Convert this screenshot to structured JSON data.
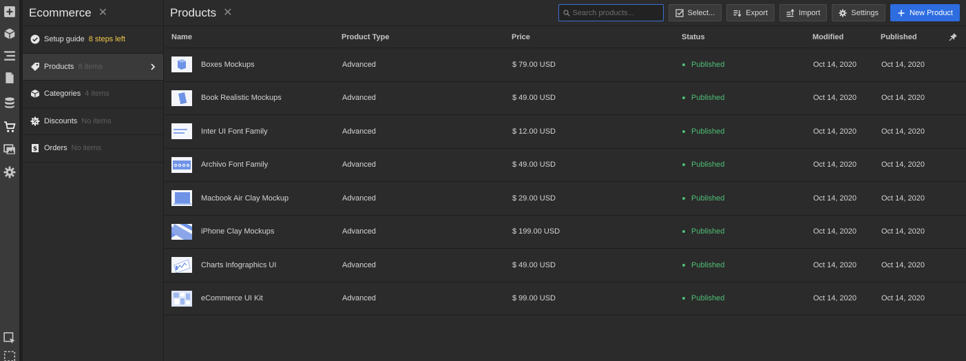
{
  "rail": {
    "icons": [
      "add-icon",
      "cube-icon",
      "navigator-icon",
      "pages-icon",
      "cms-icon",
      "ecommerce-icon",
      "assets-icon",
      "settings-icon",
      "select-icon",
      "marquee-icon"
    ]
  },
  "panel": {
    "title": "Ecommerce",
    "items": [
      {
        "label": "Setup guide",
        "count": "8 steps left",
        "icon": "check-circle-icon"
      },
      {
        "label": "Products",
        "count": "8 items",
        "icon": "tag-icon"
      },
      {
        "label": "Categories",
        "count": "4 items",
        "icon": "box-icon"
      },
      {
        "label": "Discounts",
        "count": "No items",
        "icon": "discount-icon"
      },
      {
        "label": "Orders",
        "count": "No items",
        "icon": "orders-icon"
      }
    ]
  },
  "main": {
    "title": "Products",
    "search_placeholder": "Search products...",
    "buttons": {
      "select": "Select...",
      "export": "Export",
      "import": "Import",
      "settings": "Settings",
      "new_product": "New Product"
    }
  },
  "table": {
    "columns": [
      "Name",
      "Product Type",
      "Price",
      "Status",
      "Modified",
      "Published"
    ],
    "rows": [
      {
        "name": "Boxes Mockups",
        "type": "Advanced",
        "price": "$ 79.00 USD",
        "status": "Published",
        "modified": "Oct 14, 2020",
        "published": "Oct 14, 2020"
      },
      {
        "name": "Book Realistic Mockups",
        "type": "Advanced",
        "price": "$ 49.00 USD",
        "status": "Published",
        "modified": "Oct 14, 2020",
        "published": "Oct 14, 2020"
      },
      {
        "name": "Inter UI Font Family",
        "type": "Advanced",
        "price": "$ 12.00 USD",
        "status": "Published",
        "modified": "Oct 14, 2020",
        "published": "Oct 14, 2020"
      },
      {
        "name": "Archivo Font Family",
        "type": "Advanced",
        "price": "$ 49.00 USD",
        "status": "Published",
        "modified": "Oct 14, 2020",
        "published": "Oct 14, 2020"
      },
      {
        "name": "Macbook Air Clay Mockup",
        "type": "Advanced",
        "price": "$ 29.00 USD",
        "status": "Published",
        "modified": "Oct 14, 2020",
        "published": "Oct 14, 2020"
      },
      {
        "name": "iPhone Clay Mockups",
        "type": "Advanced",
        "price": "$ 199.00 USD",
        "status": "Published",
        "modified": "Oct 14, 2020",
        "published": "Oct 14, 2020"
      },
      {
        "name": "Charts Infographics UI",
        "type": "Advanced",
        "price": "$ 49.00 USD",
        "status": "Published",
        "modified": "Oct 14, 2020",
        "published": "Oct 14, 2020"
      },
      {
        "name": "eCommerce UI Kit",
        "type": "Advanced",
        "price": "$ 99.00 USD",
        "status": "Published",
        "modified": "Oct 14, 2020",
        "published": "Oct 14, 2020"
      }
    ]
  },
  "colors": {
    "accent": "#2d6de0",
    "published": "#4fbf77",
    "setup_count": "#f2c94c"
  }
}
